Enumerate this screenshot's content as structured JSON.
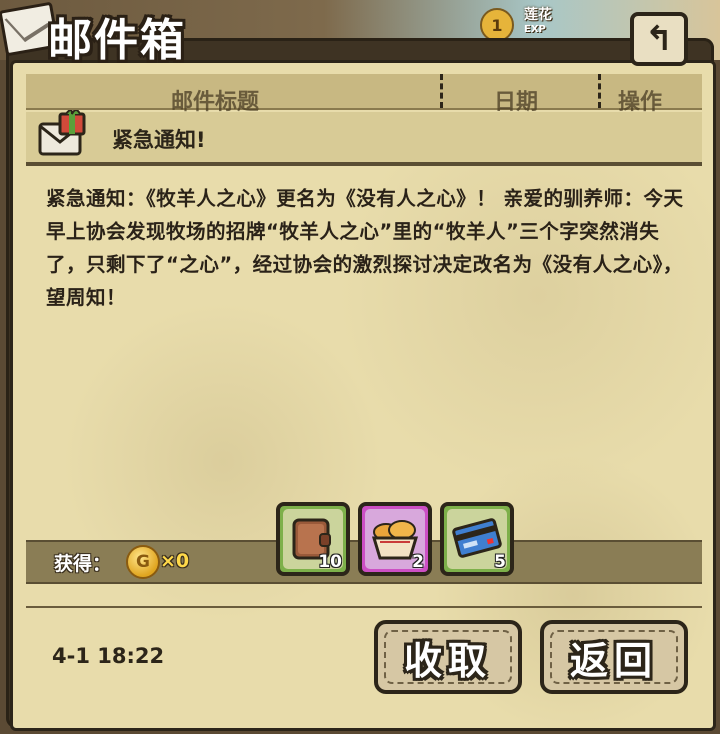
{
  "hud": {
    "player_name": "莲花",
    "exp_label": "EXP",
    "level": "1"
  },
  "window": {
    "title": "邮件箱"
  },
  "table_header": {
    "col_subject": "邮件标题",
    "col_date": "日期",
    "col_action": "操作"
  },
  "mail": {
    "title": "紧急通知!",
    "body": "紧急通知：《牧羊人之心》更名为《没有人之心》！ 亲爱的驯养师：今天早上协会发现牧场的招牌“牧羊人之心”里的“牧羊人”三个字突然消失了，只剩下了“之心”，经过协会的激烈探讨决定改名为《没有人之心》，望周知！",
    "date": "4-1 18:22"
  },
  "rewards": {
    "label": "获得：",
    "coin_symbol": "G",
    "coin_amount": "×0",
    "items": [
      {
        "icon": "wallet-icon",
        "qty": "10",
        "rarity_color": "#7db04a"
      },
      {
        "icon": "bread-basket-icon",
        "qty": "2",
        "rarity_color": "#cc4fc4"
      },
      {
        "icon": "card-icon",
        "qty": "5",
        "rarity_color": "#7db04a"
      }
    ]
  },
  "buttons": {
    "collect_label": "收取",
    "return_label": "返回"
  }
}
